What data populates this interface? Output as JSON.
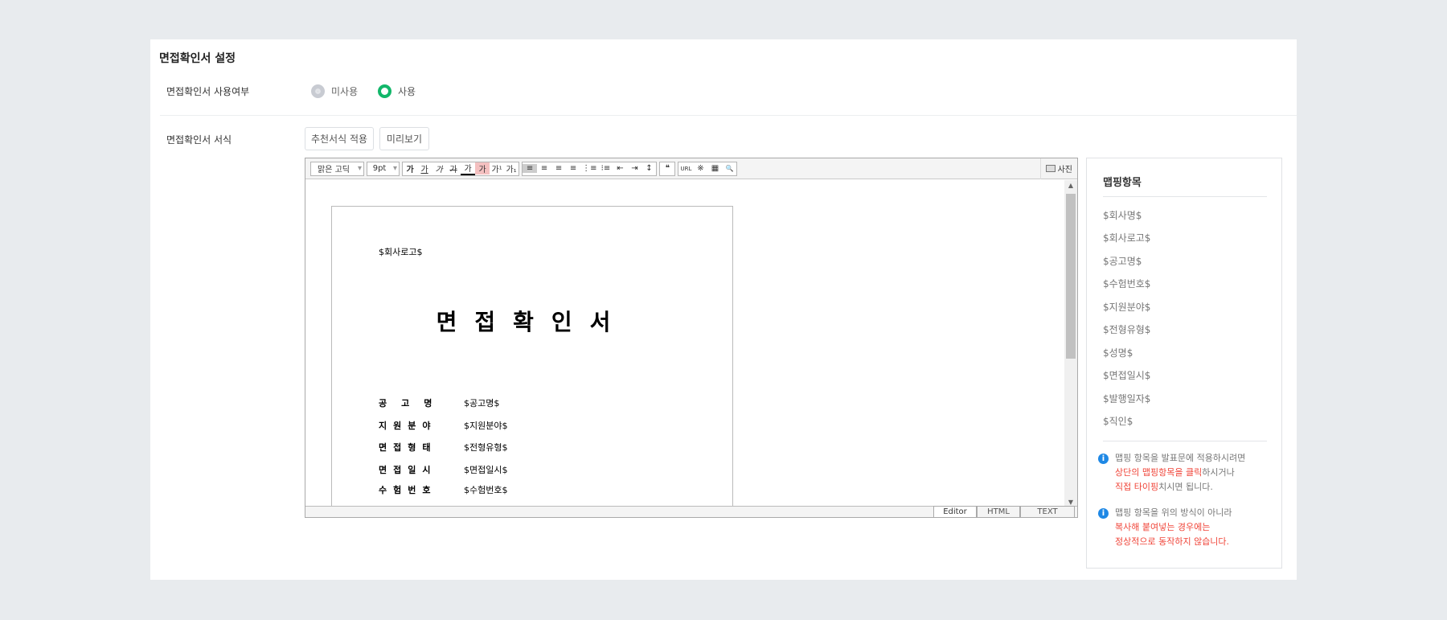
{
  "title": "면접확인서 설정",
  "usage": {
    "label": "면접확인서 사용여부",
    "options": [
      "미사용",
      "사용"
    ],
    "selected": "사용"
  },
  "format": {
    "label": "면접확인서 서식",
    "buttons": [
      "추천서식 적용",
      "미리보기"
    ]
  },
  "editor": {
    "font": "맑은 고딕",
    "size": "9pt",
    "format_buttons": [
      "가",
      "가",
      "가",
      "가",
      "가",
      "가",
      "가¹",
      "가₁"
    ],
    "align_buttons": [
      "≡",
      "≡",
      "≡",
      "≡",
      "⋮≡",
      "⁝≡",
      "⇤",
      "⇥",
      "↕"
    ],
    "quote": "❝",
    "url": "URL",
    "special": "※",
    "table": "▦",
    "find": "🔍",
    "photo": "사진",
    "tabs": [
      "Editor",
      "HTML",
      "TEXT"
    ],
    "doc": {
      "logo": "$회사로고$",
      "title": "면접확인서",
      "rows": [
        {
          "k": "공고명",
          "v": "$공고명$"
        },
        {
          "k": "지원분야",
          "v": "$지원분야$"
        },
        {
          "k": "면접형태",
          "v": "$전형유형$"
        },
        {
          "k": "면접일시",
          "v": "$면접일시$"
        },
        {
          "k": "수험번호",
          "v": "$수험번호$"
        }
      ]
    }
  },
  "mapping": {
    "title": "맵핑항목",
    "items": [
      "$회사명$",
      "$회사로고$",
      "$공고명$",
      "$수험번호$",
      "$지원분야$",
      "$전형유형$",
      "$성명$",
      "$면접일시$",
      "$발행일자$",
      "$직인$"
    ],
    "info1": {
      "l1": "맵핑 항목을 발표문에 적용하시려면",
      "l2a": "상단의 맵핑항목을 클릭",
      "l2b": "하시거나",
      "l3a": "직접 타이핑",
      "l3b": "치시면 됩니다."
    },
    "info2": {
      "l1": "맵핑 항목을 위의 방식이 아니라",
      "l2": "복사해 붙여넣는 경우에는",
      "l3": "정상적으로 동작하지 않습니다."
    }
  }
}
